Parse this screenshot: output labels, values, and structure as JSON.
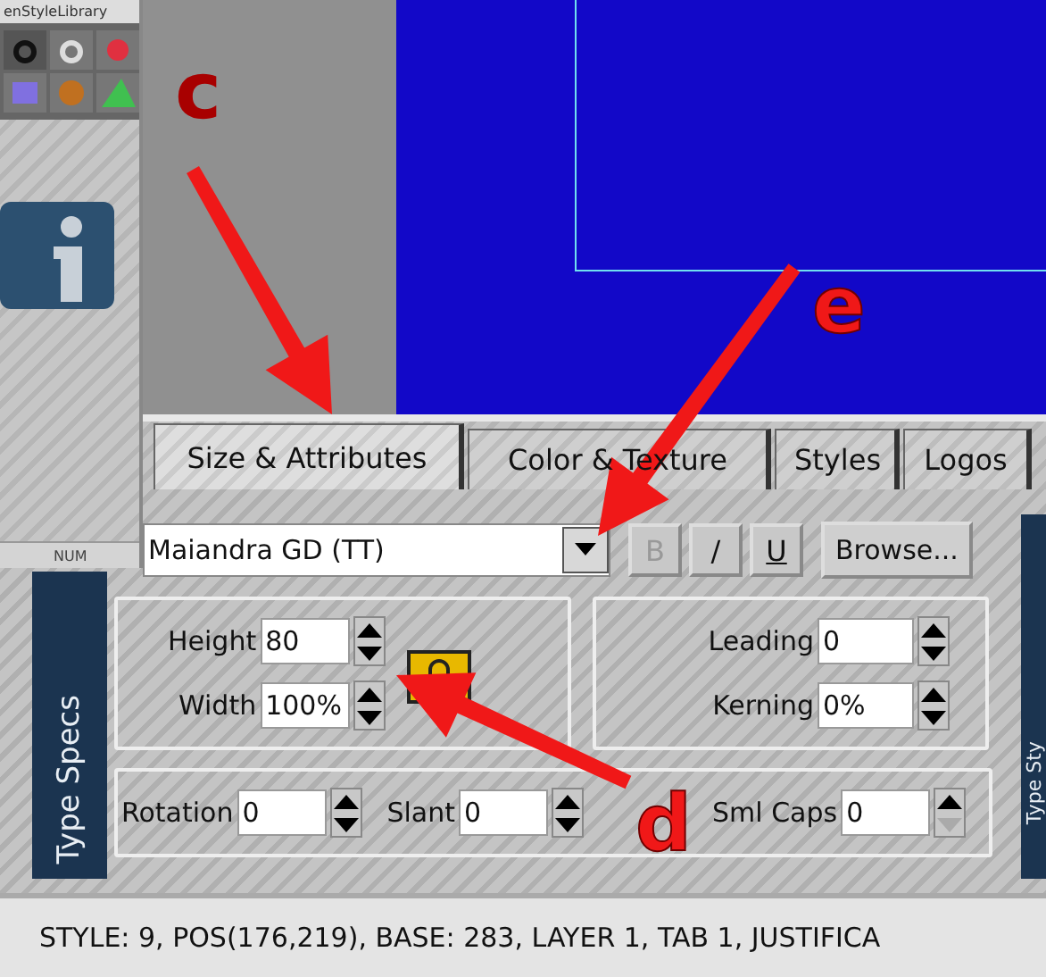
{
  "palette": {
    "title": "enStyleLibrary",
    "status": "NUM"
  },
  "tabs": [
    {
      "label": "Size & Attributes",
      "selected": true
    },
    {
      "label": "Color & Texture",
      "selected": false
    },
    {
      "label": "Styles",
      "selected": false
    },
    {
      "label": "Logos",
      "selected": false
    }
  ],
  "side_labels": {
    "left": "Type Specs",
    "right": "Type Sty"
  },
  "font": {
    "value": "Maiandra GD (TT)"
  },
  "style_buttons": [
    {
      "label": "B",
      "disabled": true
    },
    {
      "label": "/",
      "disabled": false
    },
    {
      "label": "U",
      "disabled": false
    }
  ],
  "browse_button": "Browse...",
  "size_fields": [
    {
      "label": "Height",
      "value": "80",
      "down_disabled": false
    },
    {
      "label": "Width",
      "value": "100%",
      "down_disabled": false
    }
  ],
  "spacing_fields": [
    {
      "label": "Leading",
      "value": "0",
      "down_disabled": false
    },
    {
      "label": "Kerning",
      "value": "0%",
      "down_disabled": false
    }
  ],
  "transform_fields": [
    {
      "label": "Rotation",
      "value": "0",
      "down_disabled": false
    },
    {
      "label": "Slant",
      "value": "0",
      "down_disabled": false
    },
    {
      "label": "Sml Caps",
      "value": "0",
      "down_disabled": true
    }
  ],
  "status_bar": "STYLE: 9, POS(176,219), BASE: 283, LAYER 1, TAB 1, JUSTIFICA",
  "annotations": [
    {
      "label": "c"
    },
    {
      "label": "e"
    },
    {
      "label": "d"
    }
  ]
}
